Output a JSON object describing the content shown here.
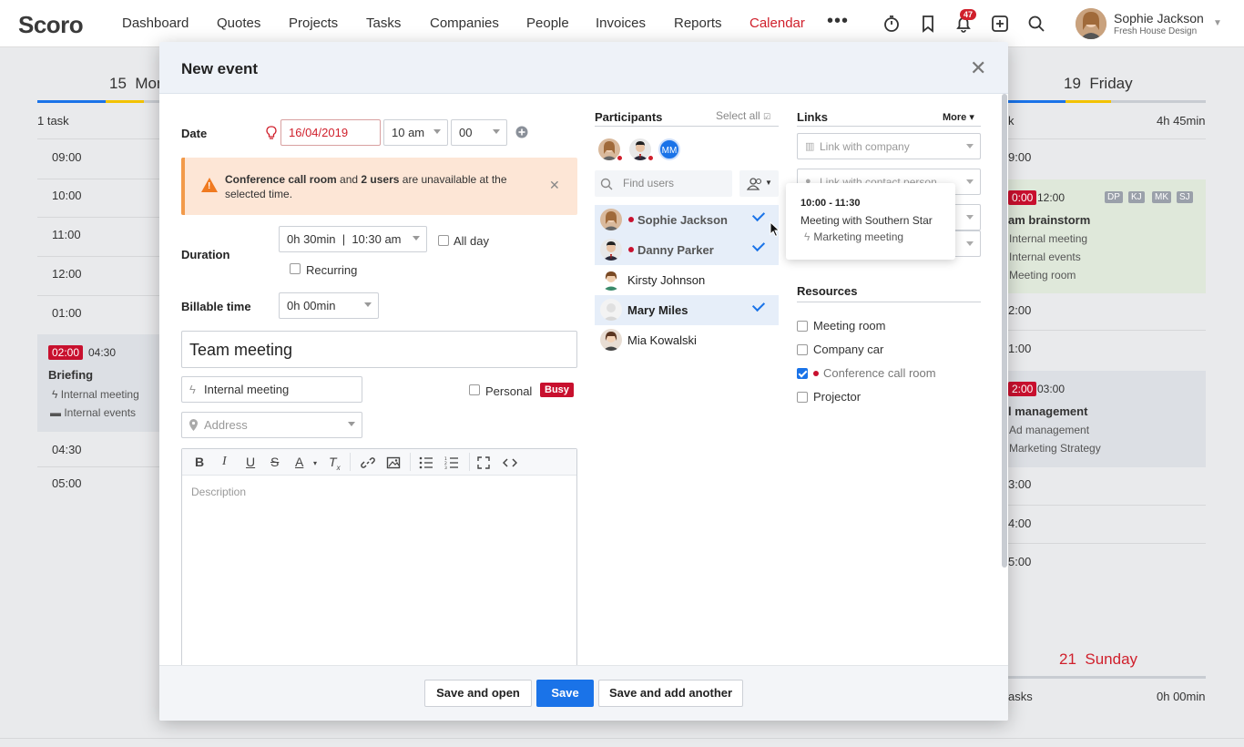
{
  "app": {
    "logo": "Scoro",
    "nav": [
      "Dashboard",
      "Quotes",
      "Projects",
      "Tasks",
      "Companies",
      "People",
      "Invoices",
      "Reports",
      "Calendar"
    ],
    "active_nav": "Calendar",
    "notifications": "47",
    "user_name": "Sophie Jackson",
    "user_company": "Fresh House Design"
  },
  "background": {
    "monday": {
      "day_num": "15",
      "day_name": "Mon",
      "tasks": "1 task"
    },
    "friday": {
      "day_num": "19",
      "day_name": "Friday",
      "tasks": "k",
      "hours": "4h 45min"
    },
    "sunday": {
      "day_num": "21",
      "day_name": "Sunday",
      "tasks": "asks",
      "hours": "0h 00min"
    },
    "left_times": [
      "09:00",
      "10:00",
      "11:00",
      "12:00",
      "01:00"
    ],
    "left_times2": [
      "04:30",
      "05:00"
    ],
    "briefing": {
      "start": "02:00",
      "end": "04:30",
      "title": "Briefing",
      "type": "Internal meeting",
      "cat": "Internal events"
    },
    "right_times": [
      "9:00",
      "2:00",
      "1:00",
      "3:00",
      "4:00",
      "5:00"
    ],
    "brainstorm": {
      "start": "0:00",
      "end": "12:00",
      "title": "am brainstorm",
      "type": "Internal meeting",
      "cat": "Internal events",
      "res": "Meeting room",
      "initials": [
        "DP",
        "KJ",
        "MK",
        "SJ"
      ]
    },
    "mgmt": {
      "start": "2:00",
      "end": "03:00",
      "title": "l management",
      "type": "Ad management",
      "cat": "Marketing Strategy"
    }
  },
  "modal": {
    "title": "New event",
    "date_label": "Date",
    "date_value": "16/04/2019",
    "hour_value": "10 am",
    "minute_value": "00",
    "warning": {
      "bold1": "Conference call room",
      "mid": " and ",
      "bold2": "2 users",
      "rest": " are unavailable at the selected time."
    },
    "duration_label": "Duration",
    "duration_value": "0h 30min",
    "end_time": "10:30 am",
    "all_day": "All day",
    "recurring": "Recurring",
    "billable_label": "Billable time",
    "billable_value": "0h 00min",
    "event_title": "Team meeting",
    "event_type": "Internal meeting",
    "personal": "Personal",
    "busy": "Busy",
    "address_placeholder": "Address",
    "description_placeholder": "Description",
    "buttons": {
      "save_open": "Save and open",
      "save": "Save",
      "save_another": "Save and add another"
    }
  },
  "participants": {
    "title": "Participants",
    "select_all": "Select all",
    "mm_initials": "MM",
    "search_placeholder": "Find users",
    "users": [
      {
        "name": "Sophie Jackson",
        "selected": true,
        "unavailable": true
      },
      {
        "name": "Danny Parker",
        "selected": true,
        "unavailable": true
      },
      {
        "name": "Kirsty Johnson",
        "selected": false,
        "unavailable": false
      },
      {
        "name": "Mary Miles",
        "selected": true,
        "unavailable": false
      },
      {
        "name": "Mia Kowalski",
        "selected": false,
        "unavailable": false
      }
    ]
  },
  "links": {
    "title": "Links",
    "more": "More",
    "company_placeholder": "Link with company",
    "contact_placeholder": "Link with contact person"
  },
  "tooltip": {
    "time": "10:00 - 11:30",
    "title": "Meeting with Southern Star",
    "type": "Marketing meeting"
  },
  "resources": {
    "title": "Resources",
    "items": [
      {
        "name": "Meeting room",
        "checked": false,
        "unavailable": false
      },
      {
        "name": "Company car",
        "checked": false,
        "unavailable": false
      },
      {
        "name": "Conference call room",
        "checked": true,
        "unavailable": true
      },
      {
        "name": "Projector",
        "checked": false,
        "unavailable": false
      }
    ]
  }
}
